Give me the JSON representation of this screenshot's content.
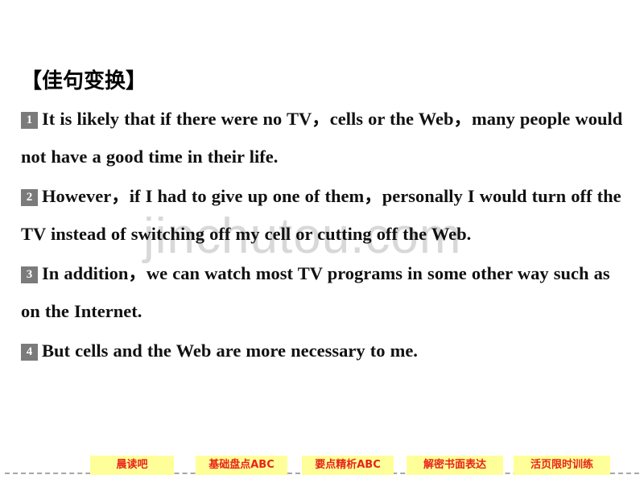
{
  "slide": {
    "title": "【佳句变换】",
    "watermark": "jinchutou.com",
    "background_color": "#ffffff",
    "text_color": "#111111",
    "badge_color": "#7b7b7b"
  },
  "sentences": [
    {
      "number": "1",
      "text": "It is likely that if there were no TV，cells or the Web，many people would not have a good time in their life."
    },
    {
      "number": "2",
      "text": "However，if I had to give up one of them，personally I would turn off the TV instead of switching off my cell or cutting off the Web."
    },
    {
      "number": "3",
      "text": "In addition，we can watch most TV programs in some other way such as on the Internet."
    },
    {
      "number": "4",
      "text": "But cells and the Web are more necessary to me."
    }
  ],
  "bottom_nav": {
    "tab_background": "#ffff99",
    "tab_text_color": "#e8241a",
    "tabs": [
      {
        "label": "晨读吧"
      },
      {
        "label": "基础盘点ABC"
      },
      {
        "label": "要点精析ABC"
      },
      {
        "label": "解密书面表达"
      },
      {
        "label": "活页限时训练"
      }
    ]
  }
}
